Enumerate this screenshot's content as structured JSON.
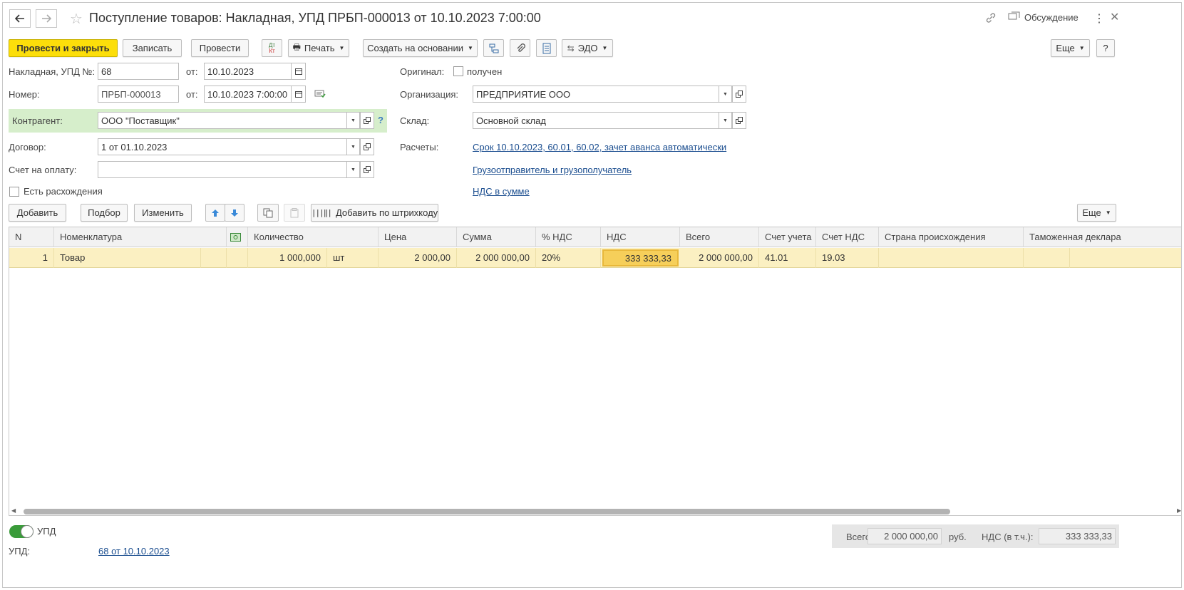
{
  "title": "Поступление товаров: Накладная, УПД ПРБП-000013 от 10.10.2023 7:00:00",
  "header_right": {
    "discussion": "Обсуждение"
  },
  "toolbar": {
    "post_close": "Провести и закрыть",
    "save": "Записать",
    "post": "Провести",
    "print": "Печать",
    "create_based": "Создать на основании",
    "edo": "ЭДО",
    "more": "Еще",
    "help": "?"
  },
  "form": {
    "invoice_label": "Накладная, УПД №:",
    "invoice_value": "68",
    "from_label": "от:",
    "invoice_date": "10.10.2023",
    "number_label": "Номер:",
    "number_value": "ПРБП-000013",
    "number_date": "10.10.2023  7:00:00",
    "counterparty_label": "Контрагент:",
    "counterparty_value": "ООО \"Поставщик\"",
    "contract_label": "Договор:",
    "contract_value": "1 от 01.10.2023",
    "invoice_pay_label": "Счет на оплату:",
    "invoice_pay_value": "",
    "discrepancy_label": "Есть расхождения",
    "original_label": "Оригинал:",
    "original_received": "получен",
    "org_label": "Организация:",
    "org_value": "ПРЕДПРИЯТИЕ ООО",
    "warehouse_label": "Склад:",
    "warehouse_value": "Основной склад",
    "payments_label": "Расчеты:",
    "payments_link": "Срок 10.10.2023, 60.01, 60.02, зачет аванса автоматически",
    "shipper_link": "Грузоотправитель и грузополучатель",
    "vat_link": "НДС в сумме"
  },
  "table_toolbar": {
    "add": "Добавить",
    "pick": "Подбор",
    "change": "Изменить",
    "barcode": "Добавить по штрихкоду",
    "more": "Еще"
  },
  "table": {
    "headers": [
      "N",
      "Номенклатура",
      "Количество",
      "Цена",
      "Сумма",
      "% НДС",
      "НДС",
      "Всего",
      "Счет учета",
      "Счет НДС",
      "Страна происхождения",
      "Таможенная деклара"
    ],
    "rows": [
      {
        "n": "1",
        "item": "Товар",
        "qty": "1 000,000",
        "unit": "шт",
        "price": "2 000,00",
        "sum": "2 000 000,00",
        "vat_rate": "20%",
        "vat": "333 333,33",
        "total": "2 000 000,00",
        "account": "41.01",
        "vat_account": "19.03",
        "country": "",
        "customs": ""
      }
    ]
  },
  "footer": {
    "upd_toggle": "УПД",
    "upd_label": "УПД:",
    "upd_link": "68 от 10.10.2023",
    "total_label": "Всего:",
    "total_value": "2 000 000,00",
    "currency": "руб.",
    "vat_label": "НДС (в т.ч.):",
    "vat_value": "333 333,33"
  },
  "colors": {
    "primary_button": "#fcde0a",
    "selected_row": "#fbf0c2",
    "active_cell": "#f6cf5a",
    "counterparty_highlight": "#d6eecb",
    "link": "#1a4d8f",
    "toggle_on": "#3a9b3a"
  }
}
